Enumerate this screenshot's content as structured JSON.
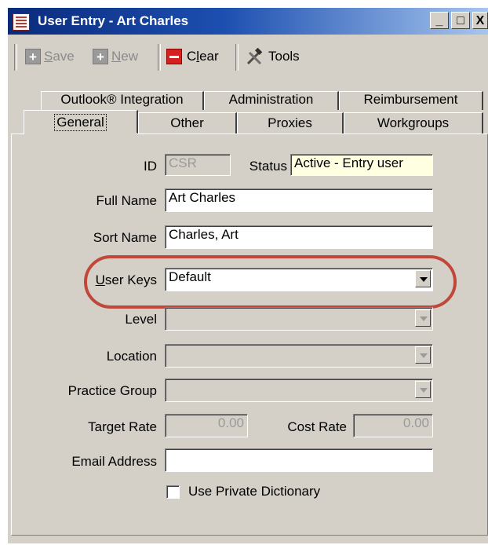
{
  "window": {
    "title": "User Entry - Art Charles",
    "title_buttons": [
      "_",
      "□",
      "X"
    ]
  },
  "toolbar": {
    "save": {
      "prefix": "S",
      "rest": "ave",
      "icon": "plus-icon",
      "enabled": false
    },
    "new": {
      "prefix": "N",
      "rest": "ew",
      "icon": "plus-icon",
      "enabled": false
    },
    "clear": {
      "prefix": "C",
      "underline": "l",
      "rest": "ear",
      "icon": "clear-icon"
    },
    "tools": {
      "label": "Tools",
      "icon": "hammer-wrench-icon"
    }
  },
  "tabs": {
    "row1": [
      "Outlook® Integration",
      "Administration",
      "Reimbursement"
    ],
    "row2": [
      "General",
      "Other",
      "Proxies",
      "Workgroups"
    ],
    "selected": "General"
  },
  "form": {
    "id": {
      "label": "ID",
      "value": "CSR"
    },
    "status": {
      "label": "Status",
      "value": "Active - Entry user"
    },
    "full_name": {
      "label": "Full Name",
      "value": "Art Charles"
    },
    "sort_name": {
      "label": "Sort Name",
      "value": "Charles, Art"
    },
    "user_keys": {
      "label_prefix": "U",
      "label_rest": "ser Keys",
      "value": "Default"
    },
    "level": {
      "label": "Level",
      "value": ""
    },
    "location": {
      "label": "Location",
      "value": ""
    },
    "practice_group": {
      "label": "Practice Group",
      "value": ""
    },
    "target_rate": {
      "label": "Target Rate",
      "value": "0.00"
    },
    "cost_rate": {
      "label": "Cost Rate",
      "value": "0.00"
    },
    "email": {
      "label": "Email Address",
      "value": ""
    },
    "private_dictionary": {
      "label": "Use Private Dictionary",
      "checked": false
    }
  },
  "colors": {
    "highlight": "#c0483a",
    "status_bg": "#ffffe1",
    "titlebar": "#0a2b7c"
  }
}
